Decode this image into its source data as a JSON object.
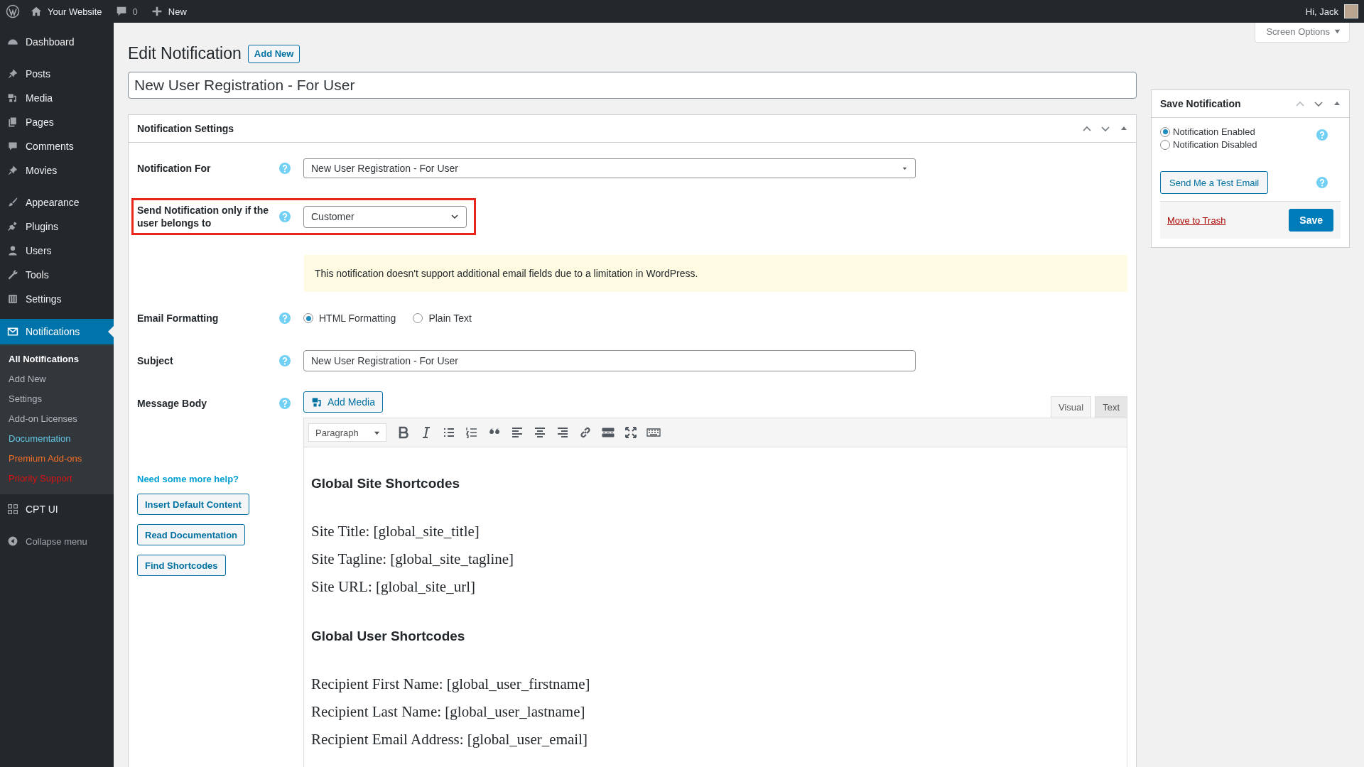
{
  "admin_bar": {
    "site": "Your Website",
    "comments": "0",
    "new": "New",
    "greeting": "Hi, Jack"
  },
  "sidebar": {
    "groups": [
      [
        {
          "label": "Dashboard",
          "selected": false
        }
      ],
      [
        {
          "label": "Posts",
          "selected": false
        },
        {
          "label": "Media",
          "selected": false
        },
        {
          "label": "Pages",
          "selected": false
        },
        {
          "label": "Comments",
          "selected": false
        },
        {
          "label": "Movies",
          "selected": false
        }
      ],
      [
        {
          "label": "Appearance",
          "selected": false
        },
        {
          "label": "Plugins",
          "selected": false
        },
        {
          "label": "Users",
          "selected": false
        },
        {
          "label": "Tools",
          "selected": false
        },
        {
          "label": "Settings",
          "selected": false
        }
      ],
      [
        {
          "label": "Notifications",
          "selected": true,
          "children": [
            {
              "label": "All Notifications",
              "selected": true,
              "color": "#ffffff"
            },
            {
              "label": "Add New",
              "selected": false,
              "color": "#b4b9be"
            },
            {
              "label": "Settings",
              "selected": false,
              "color": "#b4b9be"
            },
            {
              "label": "Add-on Licenses",
              "selected": false,
              "color": "#b4b9be"
            },
            {
              "label": "Documentation",
              "selected": false,
              "color": "#66c6e4"
            },
            {
              "label": "Premium Add-ons",
              "selected": false,
              "color": "#f56e28"
            },
            {
              "label": "Priority Support",
              "selected": false,
              "color": "#dd1111"
            }
          ]
        },
        {
          "label": "CPT UI",
          "selected": false
        }
      ]
    ],
    "collapse": "Collapse menu"
  },
  "screen_options": "Screen Options",
  "page": {
    "title": "Edit Notification",
    "add_new": "Add New",
    "post_title": "New User Registration - For User"
  },
  "settings_box": {
    "title": "Notification Settings",
    "notification_for": {
      "label": "Notification For",
      "value": "New User Registration - For User"
    },
    "user_role": {
      "label": "Send Notification only if the user belongs to",
      "value": "Customer",
      "highlighted": true
    },
    "notice": "This notification doesn't support additional email fields due to a limitation in WordPress.",
    "email_formatting": {
      "label": "Email Formatting",
      "options": [
        {
          "label": "HTML Formatting",
          "selected": true
        },
        {
          "label": "Plain Text",
          "selected": false
        }
      ]
    },
    "subject": {
      "label": "Subject",
      "value": "New User Registration - For User"
    },
    "message_body": {
      "label": "Message Body",
      "add_media": "Add Media",
      "editor_tabs": [
        {
          "label": "Visual",
          "selected": true
        },
        {
          "label": "Text",
          "selected": false
        }
      ],
      "format": "Paragraph",
      "content": [
        {
          "kind": "heading",
          "text": "Global Site Shortcodes"
        },
        {
          "kind": "line",
          "text": "Site Title: [global_site_title]"
        },
        {
          "kind": "line",
          "text": "Site Tagline: [global_site_tagline]"
        },
        {
          "kind": "line",
          "text": "Site URL: [global_site_url]"
        },
        {
          "kind": "heading",
          "text": "Global User Shortcodes"
        },
        {
          "kind": "line",
          "text": "Recipient First Name: [global_user_firstname]"
        },
        {
          "kind": "line",
          "text": "Recipient Last Name: [global_user_lastname]"
        },
        {
          "kind": "line",
          "text": "Recipient Email Address: [global_user_email]"
        }
      ]
    },
    "help": {
      "text": "Need some more help?",
      "buttons": [
        "Insert Default Content",
        "Read Documentation",
        "Find Shortcodes"
      ]
    }
  },
  "save_box": {
    "title": "Save Notification",
    "status": [
      {
        "label": "Notification Enabled",
        "selected": true
      },
      {
        "label": "Notification Disabled",
        "selected": false
      }
    ],
    "test_email": "Send Me a Test Email",
    "trash": "Move to Trash",
    "save": "Save"
  }
}
